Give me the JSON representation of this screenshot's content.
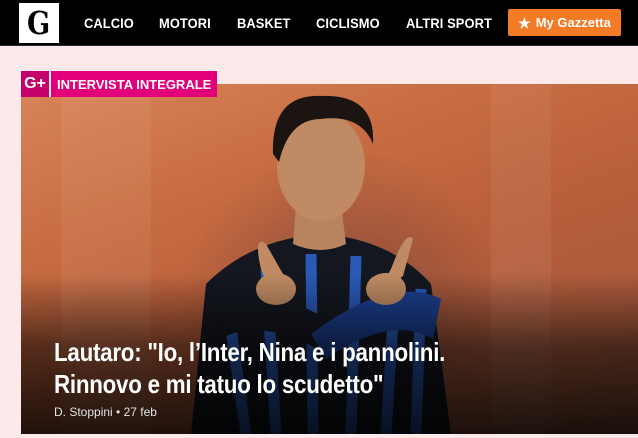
{
  "header": {
    "logo": "G",
    "nav": [
      "CALCIO",
      "MOTORI",
      "BASKET",
      "CICLISMO",
      "ALTRI SPORT",
      "..."
    ],
    "my_gazzetta": "My Gazzetta",
    "my_gazzetta_icon": "star-icon"
  },
  "article": {
    "badge_icon": "G+",
    "badge_label": "INTERVISTA INTEGRALE",
    "headline_line1": "Lautaro: \"Io, l’Inter, Nina e i pannolini.",
    "headline_line2": "Rinnovo e mi tatuo lo scudetto\"",
    "author": "D. Stoppini",
    "separator": "•",
    "date": "27 feb"
  },
  "colors": {
    "brand_pink": "#e2007a",
    "accent_orange": "#f47b25",
    "page_background": "#fde8ea"
  }
}
